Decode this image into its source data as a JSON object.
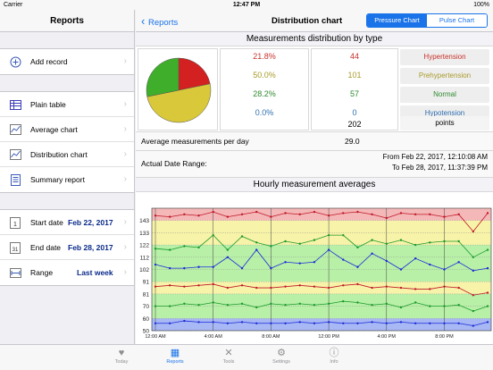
{
  "status": {
    "carrier": "Carrier",
    "time": "12:47 PM",
    "battery": "100%"
  },
  "sidebar": {
    "title": "Reports",
    "group1": [
      {
        "label": "Add record",
        "icon": "plus-icon"
      }
    ],
    "group2": [
      {
        "label": "Plain table",
        "icon": "table-icon"
      },
      {
        "label": "Average chart",
        "icon": "chart-icon"
      },
      {
        "label": "Distribution chart",
        "icon": "chart-icon"
      },
      {
        "label": "Summary report",
        "icon": "report-icon"
      }
    ],
    "group3": [
      {
        "label": "Start date",
        "value": "Feb 22, 2017",
        "icon": "calendar-1-icon"
      },
      {
        "label": "End date",
        "value": "Feb 28, 2017",
        "icon": "calendar-31-icon"
      },
      {
        "label": "Range",
        "value": "Last week",
        "icon": "range-icon"
      }
    ]
  },
  "nav": {
    "back": "Reports",
    "title": "Distribution chart",
    "seg_active": "Pressure Chart",
    "seg_inactive": "Pulse Chart"
  },
  "distribution": {
    "title": "Measurements distribution by type",
    "rows": [
      {
        "pct": "21.8%",
        "count": "44",
        "cat": "Hypertension",
        "color": "#c8322b"
      },
      {
        "pct": "50.0%",
        "count": "101",
        "cat": "Prehypertension",
        "color": "#a89a2a"
      },
      {
        "pct": "28.2%",
        "count": "57",
        "cat": "Normal",
        "color": "#2f8a2f"
      },
      {
        "pct": "0.0%",
        "count": "0",
        "cat": "Hypotension",
        "color": "#2f6fb0"
      }
    ],
    "total": "202",
    "total_label": "points",
    "pie": [
      0.218,
      0.5,
      0.282,
      0.0
    ]
  },
  "avg": {
    "label": "Average measurements per day",
    "value": "29.0"
  },
  "range": {
    "label": "Actual Date Range:",
    "from": "From Feb 22, 2017, 12:10:08 AM",
    "to": "To Feb 28, 2017, 11:37:39 PM"
  },
  "hourly": {
    "title": "Hourly measurement averages"
  },
  "chart_data": {
    "type": "line",
    "ylim": [
      50,
      150
    ],
    "y_ticks": [
      "50",
      "60",
      "70",
      "81",
      "91",
      "102",
      "112",
      "122",
      "133",
      "143"
    ],
    "x_ticks": [
      "12:00 AM",
      "4:00 AM",
      "8:00 AM",
      "12:00 PM",
      "4:00 PM",
      "8:00 PM"
    ],
    "x": [
      0,
      1,
      2,
      3,
      4,
      5,
      6,
      7,
      8,
      9,
      10,
      11,
      12,
      13,
      14,
      15,
      16,
      17,
      18,
      19,
      20,
      21,
      22,
      23
    ],
    "series": [
      {
        "color": "#c0182a",
        "values": [
          144,
          143,
          145,
          144,
          147,
          143,
          145,
          147,
          143,
          146,
          145,
          147,
          144,
          146,
          147,
          145,
          142,
          146,
          145,
          145,
          143,
          145,
          131,
          146
        ]
      },
      {
        "color": "#1a9a2a",
        "values": [
          117,
          116,
          119,
          118,
          128,
          116,
          127,
          122,
          119,
          123,
          121,
          124,
          128,
          128,
          118,
          124,
          121,
          124,
          120,
          122,
          123,
          123,
          110,
          116
        ]
      },
      {
        "color": "#1a2ad8",
        "values": [
          104,
          101,
          101,
          102,
          102,
          110,
          101,
          116,
          101,
          106,
          105,
          106,
          116,
          108,
          102,
          113,
          107,
          100,
          109,
          104,
          100,
          106,
          99,
          101
        ]
      },
      {
        "color": "#c0182a",
        "values": [
          86,
          87,
          86,
          87,
          88,
          85,
          87,
          85,
          85,
          86,
          87,
          86,
          85,
          87,
          88,
          85,
          86,
          85,
          84,
          84,
          86,
          85,
          79,
          81
        ]
      },
      {
        "color": "#1a9a2a",
        "values": [
          70,
          70,
          72,
          71,
          73,
          71,
          72,
          69,
          72,
          71,
          72,
          71,
          72,
          74,
          73,
          71,
          72,
          69,
          73,
          70,
          70,
          71,
          66,
          70
        ]
      },
      {
        "color": "#1a2ad8",
        "values": [
          56,
          56,
          58,
          57,
          57,
          56,
          57,
          56,
          56,
          56,
          57,
          56,
          57,
          56,
          56,
          57,
          56,
          57,
          56,
          56,
          56,
          56,
          54,
          57
        ]
      }
    ],
    "bands": [
      {
        "from": 140,
        "to": 150,
        "color": "#f4b8b8"
      },
      {
        "from": 120,
        "to": 140,
        "color": "#f7f3a8"
      },
      {
        "from": 90,
        "to": 120,
        "color": "#b8f0a8"
      },
      {
        "from": 80,
        "to": 90,
        "color": "#f7f3a8"
      },
      {
        "from": 60,
        "to": 80,
        "color": "#b8f0a8"
      },
      {
        "from": 50,
        "to": 60,
        "color": "#a8b8f4"
      }
    ]
  },
  "tabs": [
    {
      "label": "Today",
      "icon": "heart-icon",
      "glyph": "♥"
    },
    {
      "label": "Reports",
      "icon": "reports-icon",
      "glyph": "▦"
    },
    {
      "label": "Tools",
      "icon": "tools-icon",
      "glyph": "✕"
    },
    {
      "label": "Settings",
      "icon": "gear-icon",
      "glyph": "⚙"
    },
    {
      "label": "Info",
      "icon": "info-icon",
      "glyph": "ⓘ"
    }
  ]
}
